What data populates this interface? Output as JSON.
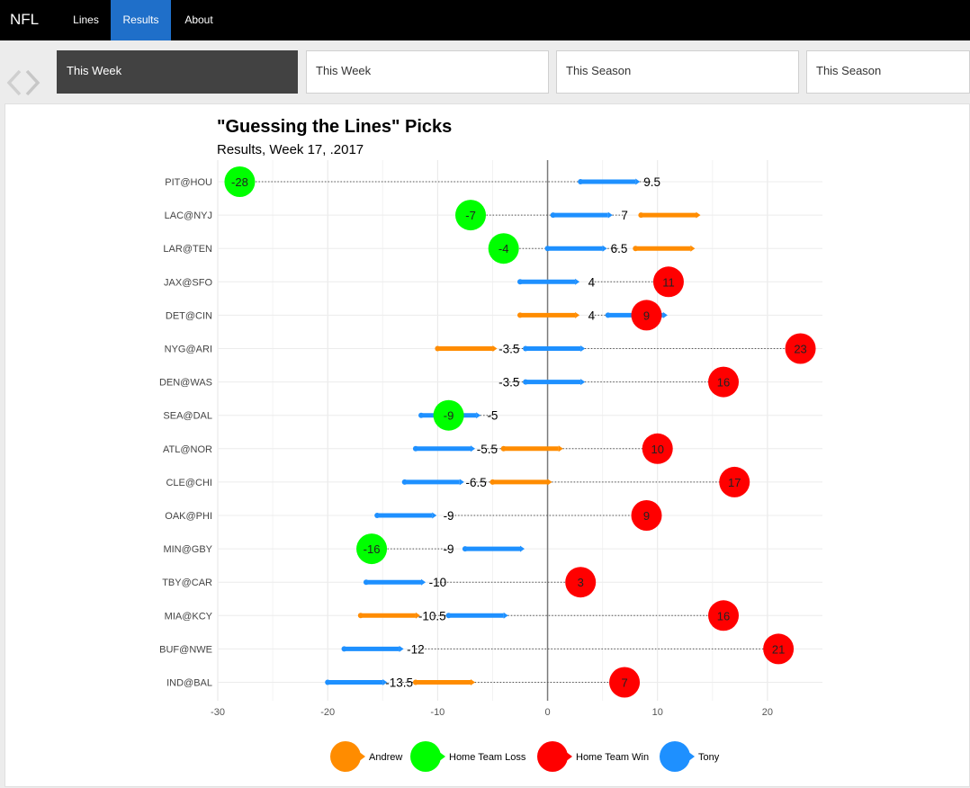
{
  "navbar": {
    "brand": "NFL",
    "items": [
      {
        "label": "Lines",
        "active": false
      },
      {
        "label": "Results",
        "active": true
      },
      {
        "label": "About",
        "active": false
      }
    ]
  },
  "tabs": [
    {
      "label": "This Week",
      "active": true
    },
    {
      "label": "This Week",
      "active": false
    },
    {
      "label": "This Season",
      "active": false
    },
    {
      "label": "This Season",
      "active": false
    }
  ],
  "colors": {
    "andrew": "#ff8c00",
    "tony": "#1e90ff",
    "home_team_loss": "#00ff00",
    "home_team_win": "#ff0000",
    "navbar_bg": "#000000",
    "active_nav": "#1f6fc9"
  },
  "chart_data": {
    "type": "scatter",
    "title": "\"Guessing the Lines\" Picks",
    "subtitle": "Results, Week 17, .2017",
    "xlim": [
      -30,
      25
    ],
    "x_ticks": [
      -30,
      -20,
      -10,
      0,
      10,
      20
    ],
    "x_tick_labels": [
      "-30",
      "-20",
      "-10",
      "0",
      "10",
      "20"
    ],
    "grid": true,
    "legend_position": "bottom",
    "legend": [
      {
        "name": "Andrew",
        "key": "andrew"
      },
      {
        "name": "Home Team Loss",
        "key": "home_team_loss"
      },
      {
        "name": "Home Team Win",
        "key": "home_team_win"
      },
      {
        "name": "Tony",
        "key": "tony"
      }
    ],
    "games": [
      {
        "game": "PIT@HOU",
        "line": 9.5,
        "line_label": "9.5",
        "result": -28,
        "result_label": "-28",
        "outcome": "home_team_loss",
        "tony": [
          3,
          8
        ],
        "andrew": null
      },
      {
        "game": "LAC@NYJ",
        "line": 7,
        "line_label": "7",
        "result": -7,
        "result_label": "-7",
        "outcome": "home_team_loss",
        "tony": [
          0.5,
          5.5
        ],
        "andrew": [
          8.5,
          13.5
        ]
      },
      {
        "game": "LAR@TEN",
        "line": 6.5,
        "line_label": "6.5",
        "result": -4,
        "result_label": "-4",
        "outcome": "home_team_loss",
        "tony": [
          0,
          5
        ],
        "andrew": [
          8,
          13
        ]
      },
      {
        "game": "JAX@SFO",
        "line": 4,
        "line_label": "4",
        "result": 11,
        "result_label": "11",
        "outcome": "home_team_win",
        "tony": [
          -2.5,
          2.5
        ],
        "andrew": null
      },
      {
        "game": "DET@CIN",
        "line": 4,
        "line_label": "4",
        "result": 9,
        "result_label": "9",
        "outcome": "home_team_win",
        "tony": [
          5.5,
          10.5
        ],
        "andrew": [
          -2.5,
          2.5
        ]
      },
      {
        "game": "NYG@ARI",
        "line": -3.5,
        "line_label": "-3.5",
        "result": 23,
        "result_label": "23",
        "outcome": "home_team_win",
        "tony": [
          -2,
          3
        ],
        "andrew": [
          -10,
          -5
        ]
      },
      {
        "game": "DEN@WAS",
        "line": -3.5,
        "line_label": "-3.5",
        "result": 16,
        "result_label": "16",
        "outcome": "home_team_win",
        "tony": [
          -2,
          3
        ],
        "andrew": null
      },
      {
        "game": "SEA@DAL",
        "line": -5,
        "line_label": "-5",
        "result": -9,
        "result_label": "-9",
        "outcome": "home_team_loss",
        "tony": [
          -11.5,
          -6.5
        ],
        "andrew": null
      },
      {
        "game": "ATL@NOR",
        "line": -5.5,
        "line_label": "-5.5",
        "result": 10,
        "result_label": "10",
        "outcome": "home_team_win",
        "tony": [
          -12,
          -7
        ],
        "andrew": [
          -4,
          1
        ]
      },
      {
        "game": "CLE@CHI",
        "line": -6.5,
        "line_label": "-6.5",
        "result": 17,
        "result_label": "17",
        "outcome": "home_team_win",
        "tony": [
          -13,
          -8
        ],
        "andrew": [
          -5,
          0
        ]
      },
      {
        "game": "OAK@PHI",
        "line": -9,
        "line_label": "-9",
        "result": 9,
        "result_label": "9",
        "outcome": "home_team_win",
        "tony": [
          -15.5,
          -10.5
        ],
        "andrew": null
      },
      {
        "game": "MIN@GBY",
        "line": -9,
        "line_label": "-9",
        "result": -16,
        "result_label": "-16",
        "outcome": "home_team_loss",
        "tony": [
          -7.5,
          -2.5
        ],
        "andrew": null
      },
      {
        "game": "TBY@CAR",
        "line": -10,
        "line_label": "-10",
        "result": 3,
        "result_label": "3",
        "outcome": "home_team_win",
        "tony": [
          -16.5,
          -11.5
        ],
        "andrew": null
      },
      {
        "game": "MIA@KCY",
        "line": -10.5,
        "line_label": "-10.5",
        "result": 16,
        "result_label": "16",
        "outcome": "home_team_win",
        "tony": [
          -9,
          -4
        ],
        "andrew": [
          -17,
          -12
        ]
      },
      {
        "game": "BUF@NWE",
        "line": -12,
        "line_label": "-12",
        "result": 21,
        "result_label": "21",
        "outcome": "home_team_win",
        "tony": [
          -18.5,
          -13.5
        ],
        "andrew": null
      },
      {
        "game": "IND@BAL",
        "line": -13.5,
        "line_label": "-13.5",
        "result": 7,
        "result_label": "7",
        "outcome": "home_team_win",
        "tony": [
          -20,
          -15
        ],
        "andrew": [
          -12,
          -7
        ]
      }
    ]
  }
}
